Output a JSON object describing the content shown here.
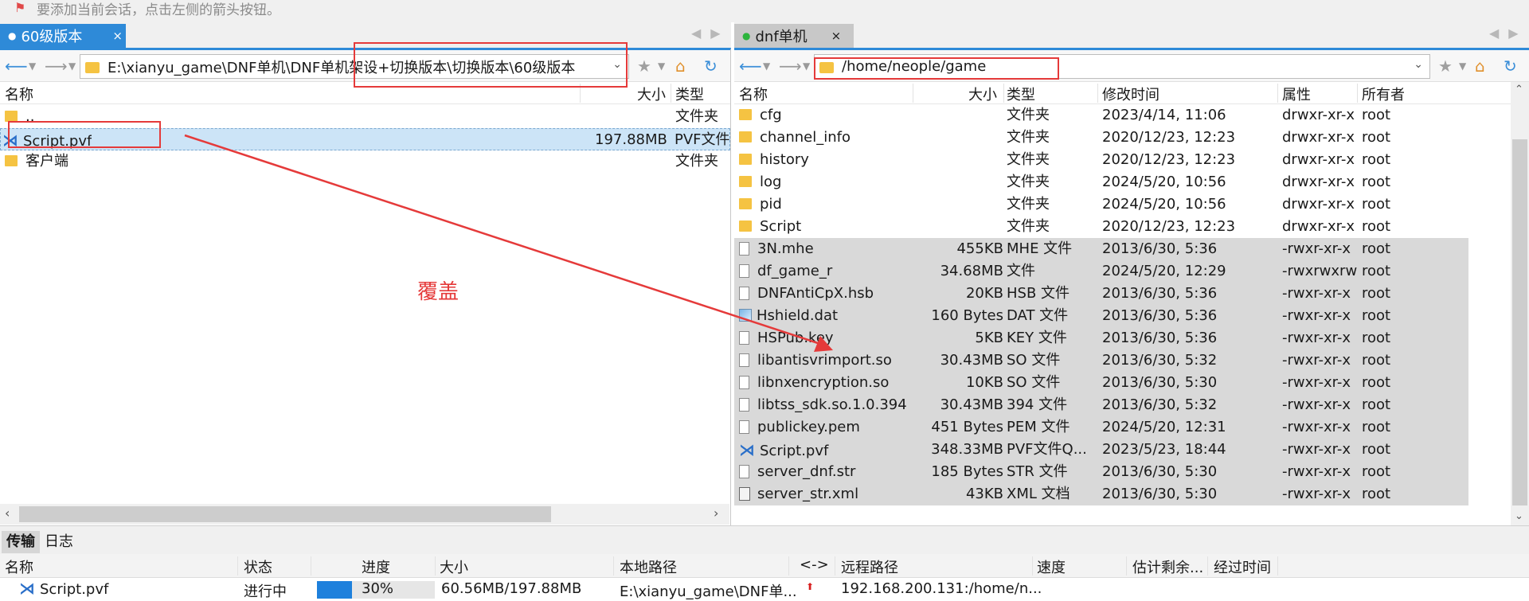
{
  "hint_text": "要添加当前会话，点击左侧的箭头按钮。",
  "left_tab": {
    "label": "60级版本",
    "close": "×"
  },
  "right_tab": {
    "label": "dnf单机",
    "close": "×"
  },
  "left_path": "E:\\xianyu_game\\DNF单机\\DNF单机架设+切换版本\\切换版本\\60级版本",
  "right_path": "/home/neople/game",
  "left_columns": [
    "名称",
    "大小",
    "类型"
  ],
  "left_rows": [
    {
      "name": "..",
      "size": "",
      "type": "文件夹",
      "icon": "folder-icon"
    },
    {
      "name": "Script.pvf",
      "size": "197.88MB",
      "type": "PVF文件",
      "icon": "vscode-icon"
    },
    {
      "name": "客户端",
      "size": "",
      "type": "文件夹",
      "icon": "folder-icon"
    }
  ],
  "right_columns": [
    "名称",
    "大小",
    "类型",
    "修改时间",
    "属性",
    "所有者"
  ],
  "right_rows": [
    {
      "name": "cfg",
      "size": "",
      "type": "文件夹",
      "mtime": "2023/4/14, 11:06",
      "perm": "drwxr-xr-x",
      "owner": "root",
      "icon": "folder-icon"
    },
    {
      "name": "channel_info",
      "size": "",
      "type": "文件夹",
      "mtime": "2020/12/23, 12:23",
      "perm": "drwxr-xr-x",
      "owner": "root",
      "icon": "folder-icon"
    },
    {
      "name": "history",
      "size": "",
      "type": "文件夹",
      "mtime": "2020/12/23, 12:23",
      "perm": "drwxr-xr-x",
      "owner": "root",
      "icon": "folder-icon"
    },
    {
      "name": "log",
      "size": "",
      "type": "文件夹",
      "mtime": "2024/5/20, 10:56",
      "perm": "drwxr-xr-x",
      "owner": "root",
      "icon": "folder-icon"
    },
    {
      "name": "pid",
      "size": "",
      "type": "文件夹",
      "mtime": "2024/5/20, 10:56",
      "perm": "drwxr-xr-x",
      "owner": "root",
      "icon": "folder-icon"
    },
    {
      "name": "Script",
      "size": "",
      "type": "文件夹",
      "mtime": "2020/12/23, 12:23",
      "perm": "drwxr-xr-x",
      "owner": "root",
      "icon": "folder-icon"
    },
    {
      "name": "3N.mhe",
      "size": "455KB",
      "type": "MHE 文件",
      "mtime": "2013/6/30, 5:36",
      "perm": "-rwxr-xr-x",
      "owner": "root",
      "icon": "file-icon"
    },
    {
      "name": "df_game_r",
      "size": "34.68MB",
      "type": "文件",
      "mtime": "2024/5/20, 12:29",
      "perm": "-rwxrwxrwx",
      "owner": "root",
      "icon": "file-icon"
    },
    {
      "name": "DNFAntiCpX.hsb",
      "size": "20KB",
      "type": "HSB 文件",
      "mtime": "2013/6/30, 5:36",
      "perm": "-rwxr-xr-x",
      "owner": "root",
      "icon": "file-icon"
    },
    {
      "name": "Hshield.dat",
      "size": "160 Bytes",
      "type": "DAT 文件",
      "mtime": "2013/6/30, 5:36",
      "perm": "-rwxr-xr-x",
      "owner": "root",
      "icon": "dat-icon"
    },
    {
      "name": "HSPub.key",
      "size": "5KB",
      "type": "KEY 文件",
      "mtime": "2013/6/30, 5:36",
      "perm": "-rwxr-xr-x",
      "owner": "root",
      "icon": "file-icon"
    },
    {
      "name": "libantisvrimport.so",
      "size": "30.43MB",
      "type": "SO 文件",
      "mtime": "2013/6/30, 5:32",
      "perm": "-rwxr-xr-x",
      "owner": "root",
      "icon": "file-icon"
    },
    {
      "name": "libnxencryption.so",
      "size": "10KB",
      "type": "SO 文件",
      "mtime": "2013/6/30, 5:30",
      "perm": "-rwxr-xr-x",
      "owner": "root",
      "icon": "file-icon"
    },
    {
      "name": "libtss_sdk.so.1.0.394",
      "size": "30.43MB",
      "type": "394 文件",
      "mtime": "2013/6/30, 5:32",
      "perm": "-rwxr-xr-x",
      "owner": "root",
      "icon": "file-icon"
    },
    {
      "name": "publickey.pem",
      "size": "451 Bytes",
      "type": "PEM 文件",
      "mtime": "2024/5/20, 12:31",
      "perm": "-rwxr-xr-x",
      "owner": "root",
      "icon": "file-icon"
    },
    {
      "name": "Script.pvf",
      "size": "348.33MB",
      "type": "PVF文件Q...",
      "mtime": "2023/5/23, 18:44",
      "perm": "-rwxr-xr-x",
      "owner": "root",
      "icon": "vscode-icon"
    },
    {
      "name": "server_dnf.str",
      "size": "185 Bytes",
      "type": "STR 文件",
      "mtime": "2013/6/30, 5:30",
      "perm": "-rwxr-xr-x",
      "owner": "root",
      "icon": "file-icon"
    },
    {
      "name": "server_str.xml",
      "size": "43KB",
      "type": "XML 文档",
      "mtime": "2013/6/30, 5:30",
      "perm": "-rwxr-xr-x",
      "owner": "root",
      "icon": "xml-icon"
    }
  ],
  "annotation_label": "覆盖",
  "bottom_tabs": [
    "传输",
    "日志"
  ],
  "transfer_columns": [
    "名称",
    "状态",
    "进度",
    "大小",
    "本地路径",
    "<->",
    "远程路径",
    "速度",
    "估计剩余...",
    "经过时间"
  ],
  "transfer_row": {
    "name": "Script.pvf",
    "status": "进行中",
    "progress_label": "30%",
    "progress": 0.3,
    "size": "60.56MB/197.88MB",
    "local_path": "E:\\xianyu_game\\DNF单...",
    "remote_path": "192.168.200.131:/home/n..."
  },
  "colors": {
    "accent": "#2e8ad8",
    "annotation": "#e53a3a",
    "progress": "#1e80dc"
  }
}
